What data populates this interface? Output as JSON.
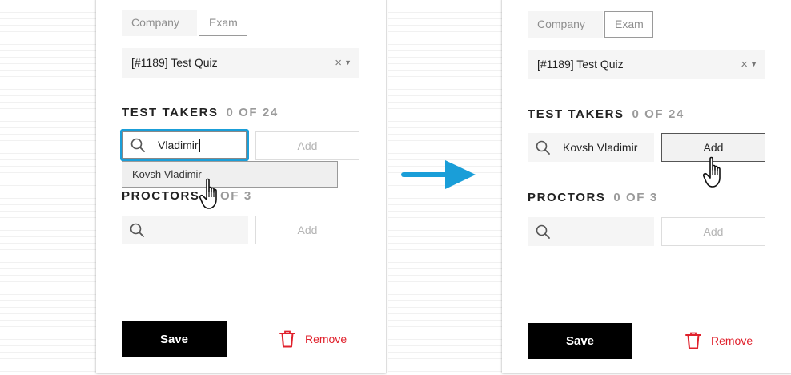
{
  "before": {
    "tabs": {
      "company": "Company",
      "exam": "Exam"
    },
    "quiz_select": {
      "value": "[#1189] Test Quiz",
      "clear_glyph": "×",
      "caret_glyph": "▼"
    },
    "test_takers": {
      "title": "TEST TAKERS",
      "count": "0 OF 24",
      "search_value": "Vladimir",
      "add_label": "Add"
    },
    "dropdown_option": "Kovsh Vladimir",
    "proctors": {
      "title": "PROCTORS",
      "count": "0 OF 3",
      "search_value": "",
      "add_label": "Add"
    },
    "save_label": "Save",
    "remove_label": "Remove"
  },
  "after": {
    "tabs": {
      "company": "Company",
      "exam": "Exam"
    },
    "quiz_select": {
      "value": "[#1189] Test Quiz",
      "clear_glyph": "×",
      "caret_glyph": "▼"
    },
    "test_takers": {
      "title": "TEST TAKERS",
      "count": "0 OF 24",
      "search_value": "Kovsh Vladimir",
      "add_label": "Add"
    },
    "proctors": {
      "title": "PROCTORS",
      "count": "0 OF 3",
      "search_value": "",
      "add_label": "Add"
    },
    "save_label": "Save",
    "remove_label": "Remove"
  },
  "colors": {
    "focus_ring": "#1a9ed8",
    "arrow": "#1a9ed8",
    "remove": "#e0212c",
    "save_bg": "#000000"
  },
  "icons": [
    "search-icon",
    "close-icon",
    "chevron-down-icon",
    "trash-icon",
    "hand-pointer-icon",
    "arrow-right-icon"
  ]
}
